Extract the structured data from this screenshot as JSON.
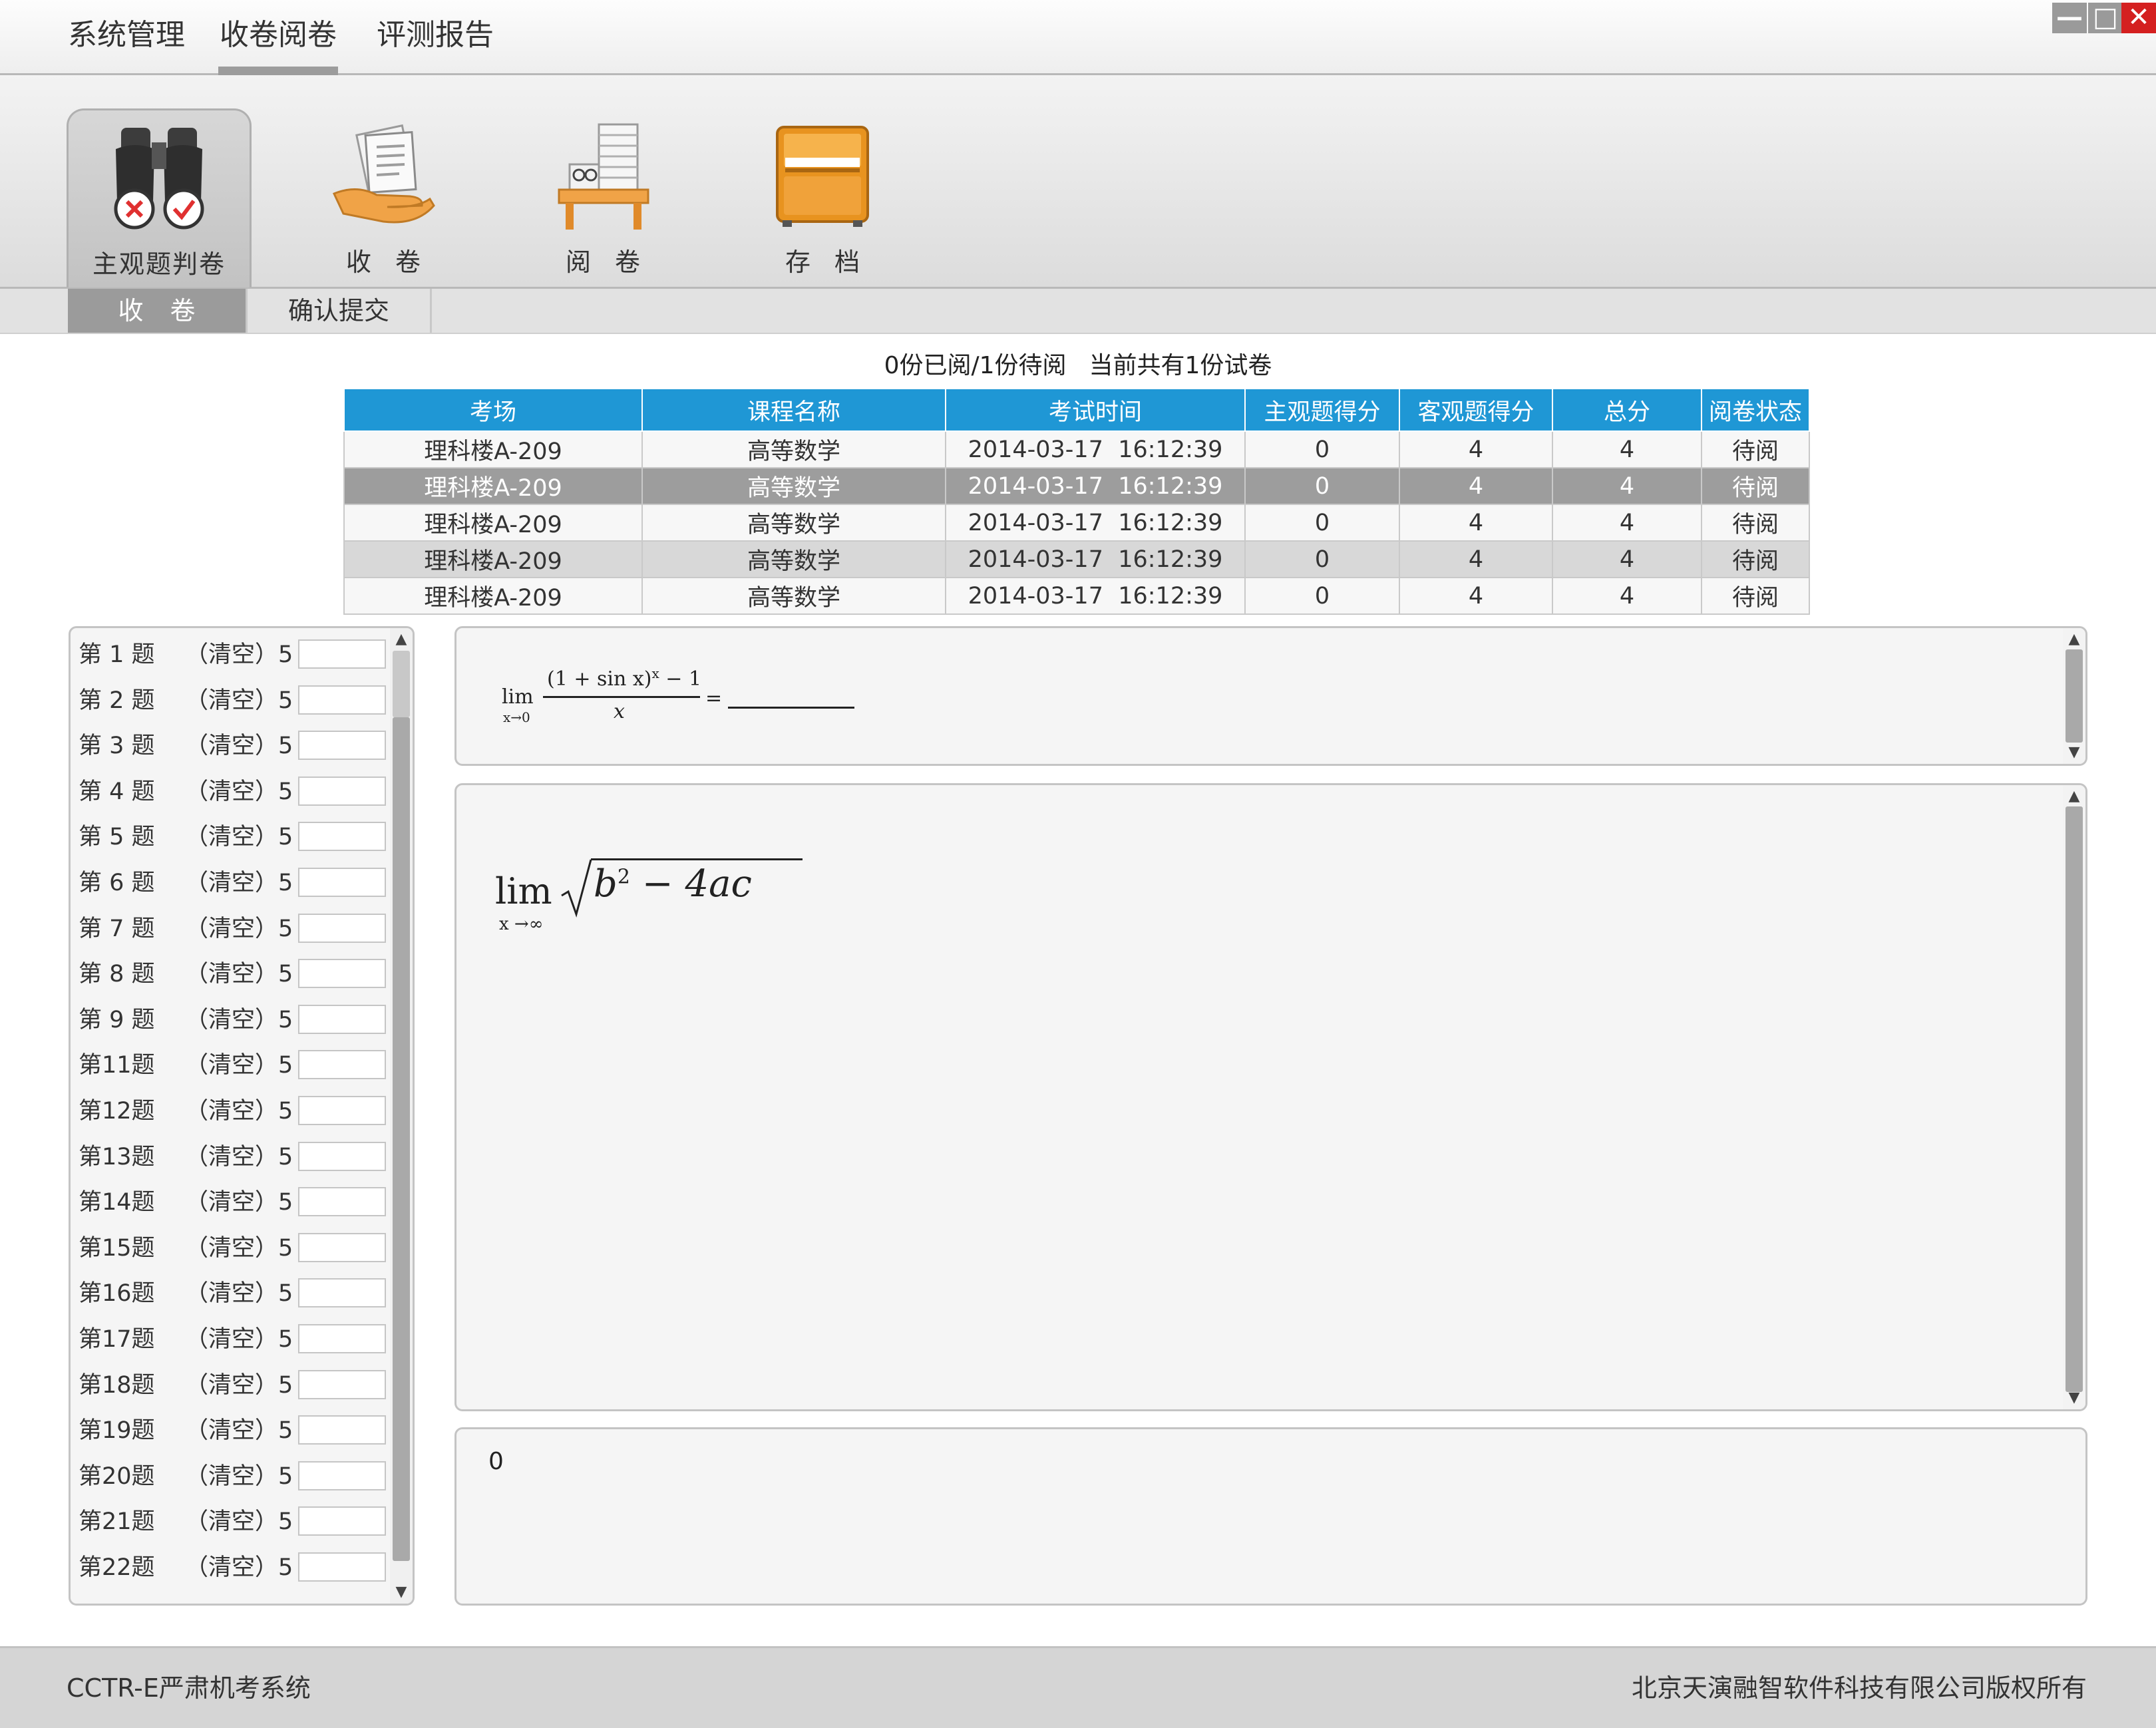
{
  "menu": [
    "系统管理",
    "收卷阅卷",
    "评测报告"
  ],
  "window_buttons": {
    "minimize": "—",
    "maximize": "□",
    "close": "✕"
  },
  "toolbar": {
    "tools": [
      {
        "label": "主观题判卷",
        "icon": "binoculars-icon"
      },
      {
        "label": "收卷",
        "icon": "hand-papers-icon"
      },
      {
        "label": "阅卷",
        "icon": "desk-papers-icon"
      },
      {
        "label": "存档",
        "icon": "archive-box-icon"
      }
    ]
  },
  "subtabs": [
    "收卷",
    "确认提交"
  ],
  "status": {
    "progress": "0份已阅/1份待阅",
    "total": "当前共有1份试卷"
  },
  "table": {
    "headers": [
      "考场",
      "课程名称",
      "考试时间",
      "主观题得分",
      "客观题得分",
      "总分",
      "阅卷状态"
    ],
    "rows": [
      [
        "理科楼A-209",
        "高等数学",
        "2014-03-17  16:12:39",
        "0",
        "4",
        "4",
        "待阅"
      ],
      [
        "理科楼A-209",
        "高等数学",
        "2014-03-17  16:12:39",
        "0",
        "4",
        "4",
        "待阅"
      ],
      [
        "理科楼A-209",
        "高等数学",
        "2014-03-17  16:12:39",
        "0",
        "4",
        "4",
        "待阅"
      ],
      [
        "理科楼A-209",
        "高等数学",
        "2014-03-17  16:12:39",
        "0",
        "4",
        "4",
        "待阅"
      ],
      [
        "理科楼A-209",
        "高等数学",
        "2014-03-17  16:12:39",
        "0",
        "4",
        "4",
        "待阅"
      ]
    ],
    "selected_row": 1
  },
  "questions": [
    {
      "name": "第 1 题",
      "clear": "（清空）",
      "score": "5"
    },
    {
      "name": "第 2 题",
      "clear": "（清空）",
      "score": "5"
    },
    {
      "name": "第 3 题",
      "clear": "（清空）",
      "score": "5"
    },
    {
      "name": "第 4 题",
      "clear": "（清空）",
      "score": "5"
    },
    {
      "name": "第 5 题",
      "clear": "（清空）",
      "score": "5"
    },
    {
      "name": "第 6 题",
      "clear": "（清空）",
      "score": "5"
    },
    {
      "name": "第 7 题",
      "clear": "（清空）",
      "score": "5"
    },
    {
      "name": "第 8 题",
      "clear": "（清空）",
      "score": "5"
    },
    {
      "name": "第 9 题",
      "clear": "（清空）",
      "score": "5"
    },
    {
      "name": "第11题",
      "clear": "（清空）",
      "score": "5"
    },
    {
      "name": "第12题",
      "clear": "（清空）",
      "score": "5"
    },
    {
      "name": "第13题",
      "clear": "（清空）",
      "score": "5"
    },
    {
      "name": "第14题",
      "clear": "（清空）",
      "score": "5"
    },
    {
      "name": "第15题",
      "clear": "（清空）",
      "score": "5"
    },
    {
      "name": "第16题",
      "clear": "（清空）",
      "score": "5"
    },
    {
      "name": "第17题",
      "clear": "（清空）",
      "score": "5"
    },
    {
      "name": "第18题",
      "clear": "（清空）",
      "score": "5"
    },
    {
      "name": "第19题",
      "clear": "（清空）",
      "score": "5"
    },
    {
      "name": "第20题",
      "clear": "（清空）",
      "score": "5"
    },
    {
      "name": "第21题",
      "clear": "（清空）",
      "score": "5"
    },
    {
      "name": "第22题",
      "clear": "（清空）",
      "score": "5"
    }
  ],
  "question_pane": {
    "lim": "lim",
    "lim_sub": "x→0",
    "numerator": "(1 + sin x)",
    "exponent": "x",
    "numerator_tail": " − 1",
    "denominator": "x",
    "equals": "="
  },
  "answer_pane": {
    "lim": "lim",
    "lim_sub": "x →∞",
    "radicand_b": "b",
    "radicand_exp": "2",
    "radicand_tail": " − 4ac"
  },
  "score_pane": {
    "value": "0"
  },
  "footer": {
    "left": "CCTR-E严肃机考系统",
    "right": "北京天演融智软件科技有限公司版权所有"
  }
}
